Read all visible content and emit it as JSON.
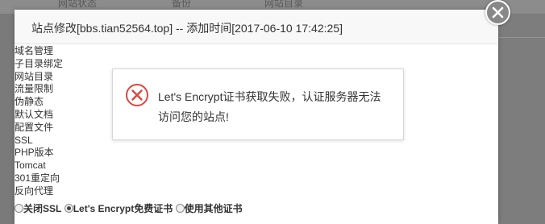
{
  "background": {
    "tabs": [
      "网站状态",
      "备份",
      "网站目录"
    ]
  },
  "dialog": {
    "title": "站点修改[bbs.tian52564.top] -- 添加时间[2017-06-10 17:42:25]",
    "close_icon": "close-icon"
  },
  "menu": {
    "items": [
      "域名管理",
      "子目录绑定",
      "网站目录",
      "流量限制",
      "伪静态",
      "默认文档",
      "配置文件",
      "SSL",
      "PHP版本",
      "Tomcat",
      "301重定向",
      "反向代理"
    ]
  },
  "ssl": {
    "options": [
      {
        "label": "关闭SSL",
        "checked": false
      },
      {
        "label": "Let's Encrypt免费证书",
        "checked": true
      },
      {
        "label": "使用其他证书",
        "checked": false
      }
    ]
  },
  "toast": {
    "icon": "error-icon",
    "message": "Let's Encrypt证书获取失败，认证服务器无法访问您的站点!"
  },
  "colors": {
    "overlay": "#7a7a7a",
    "error_red": "#e0463e",
    "close_button": "#888888"
  }
}
